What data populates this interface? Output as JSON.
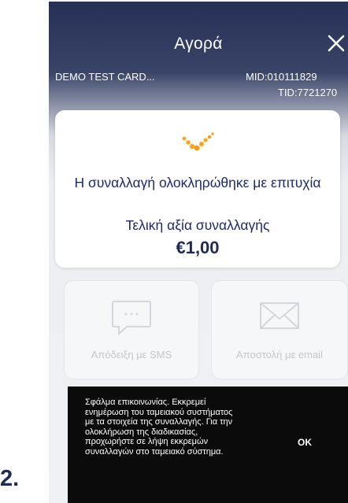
{
  "step_label": "2.",
  "header": {
    "title": "Αγορά",
    "close_icon": "close-icon",
    "card_name": "DEMO TEST CARD...",
    "mid": "MID:010111829",
    "tid": "TID:7721270"
  },
  "result": {
    "icon": "check-icon",
    "message": "Η συναλλαγή ολοκληρώθηκε με επιτυχία",
    "amount_label": "Τελική αξία συναλλαγής",
    "amount": "€1,00"
  },
  "actions": [
    {
      "label": "Απόδειξη με SMS",
      "icon": "sms-icon"
    },
    {
      "label": "Αποστολή με email",
      "icon": "email-icon"
    }
  ],
  "snackbar": {
    "message": "Σφάλμα επικοινωνίας. Εκκρεμεί ενημέρωση του ταμειακού συστήματος με τα στοιχεία της συναλλαγής. Για την ολοκλήρωση της διαδικασίας, προχωρήστε σε λήψη εκκρεμών συναλλαγών στο ταμειακό σύστημα.",
    "action": "OK"
  },
  "colors": {
    "header": "#263056",
    "accent": "#f5a623",
    "text_primary": "#1e2a6e",
    "snackbar_bg": "#0b0b0b"
  }
}
